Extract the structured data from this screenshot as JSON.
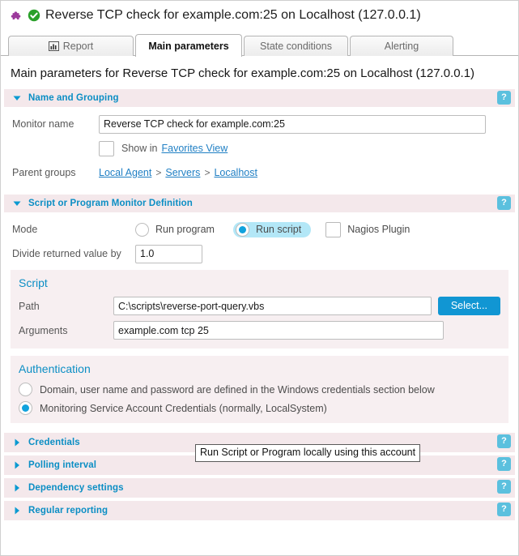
{
  "window": {
    "title": "Reverse TCP check for example.com:25 on Localhost (127.0.0.1)",
    "monitor_icon": "puzzle-piece-icon",
    "status_icon": "status-ok-check-icon"
  },
  "tabs": [
    {
      "label": "Report",
      "icon": "bar-chart-icon",
      "selected": false
    },
    {
      "label": "Main parameters",
      "icon": "",
      "selected": true
    },
    {
      "label": "State conditions",
      "icon": "",
      "selected": false
    },
    {
      "label": "Alerting",
      "icon": "",
      "selected": false
    }
  ],
  "page_heading": "Main parameters for Reverse TCP check for example.com:25 on Localhost (127.0.0.1)",
  "help_label": "?",
  "sections": {
    "name_grouping": {
      "title": "Name and Grouping",
      "expanded": true,
      "monitor_name_label": "Monitor name",
      "monitor_name_value": "Reverse TCP check for example.com:25",
      "monitor_name_placeholder": "",
      "favorites_prefix": "Show in",
      "favorites_link": "Favorites View",
      "favorites_checked": false,
      "parent_groups_label": "Parent groups",
      "parent_groups": [
        "Local Agent",
        "Servers",
        "Localhost"
      ],
      "crumb_separator": ">"
    },
    "script_monitor": {
      "title": "Script or Program Monitor Definition",
      "expanded": true,
      "mode_label": "Mode",
      "mode_options": [
        {
          "label": "Run program",
          "type": "radio",
          "selected": false,
          "highlighted": false
        },
        {
          "label": "Run script",
          "type": "radio",
          "selected": true,
          "highlighted": true
        },
        {
          "label": "Nagios Plugin",
          "type": "checkbox",
          "selected": false,
          "highlighted": false
        }
      ],
      "divide_label": "Divide returned value by",
      "divide_value": "1.0",
      "script": {
        "title": "Script",
        "path_label": "Path",
        "path_value": "C:\\scripts\\reverse-port-query.vbs",
        "select_button": "Select...",
        "arguments_label": "Arguments",
        "arguments_value": "example.com tcp 25"
      },
      "authentication": {
        "title": "Authentication",
        "options": [
          {
            "label": "Domain, user name and password are defined in the Windows credentials section below",
            "selected": false
          },
          {
            "label": "Monitoring Service Account Credentials (normally, LocalSystem)",
            "selected": true
          }
        ]
      }
    },
    "collapsed": [
      {
        "title": "Credentials"
      },
      {
        "title": "Polling interval"
      },
      {
        "title": "Dependency settings"
      },
      {
        "title": "Regular reporting"
      }
    ]
  },
  "tooltip": {
    "text": "Run Script or Program locally using this account"
  },
  "colors": {
    "accent_blue": "#0b8ec4",
    "link_blue": "#1f7fc4",
    "header_pink": "#f4e8eb",
    "panel_pink": "#f7eff1",
    "radio_fill": "#11a2dd",
    "highlight_cyan": "#b3e7f7",
    "help_blue": "#5bc0de",
    "button_blue": "#1196d3",
    "status_green": "#2aa02a",
    "puzzle_purple": "#9c3a9c"
  }
}
